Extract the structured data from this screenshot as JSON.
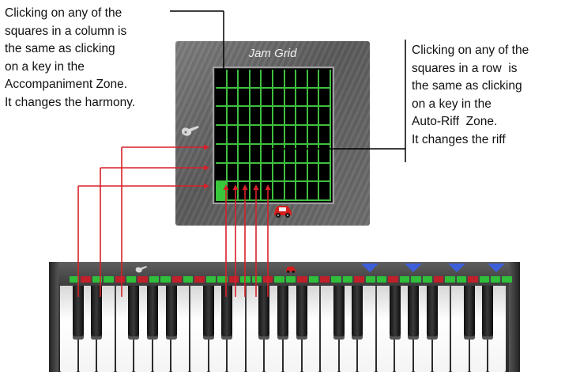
{
  "annotations": {
    "left": "Clicking on any of the\nsquares in a column is\nthe same as clicking\non a key in the\nAccompaniment Zone.\nIt changes the harmony.",
    "right": "Clicking on any of the\nsquares in a row  is\nthe same as clicking\non a key in the\nAuto-Riff  Zone.\nIt changes the riff"
  },
  "jam_grid": {
    "title": "Jam Grid",
    "columns": 10,
    "rows": 7,
    "active_cell": {
      "row": 7,
      "column": 1
    },
    "grid_line_color": "#3fbf3f",
    "active_color": "#37c93b",
    "harmony_icon": "guitar-icon",
    "riff_icon": "car-icon"
  },
  "keyboard": {
    "zone_icons": [
      "guitar-icon",
      "car-icon"
    ],
    "led_colors": {
      "green": "#2fbf3a",
      "red": "#c0202a",
      "blue": "#3d5fd9"
    },
    "arrow_color": "#d8202a"
  }
}
